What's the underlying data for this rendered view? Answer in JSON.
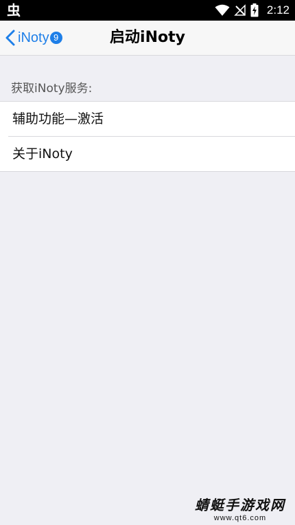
{
  "status_bar": {
    "left_icon_glyph": "虫",
    "time": "2:12",
    "icons": [
      "wifi-icon",
      "signal-off-icon",
      "battery-charging-icon"
    ]
  },
  "nav": {
    "back_label": "iNoty",
    "badge_count": "9",
    "title": "启动iNoty",
    "accent_color": "#1e7fe8"
  },
  "section": {
    "header": "获取iNoty服务:",
    "items": [
      {
        "label": "辅助功能—激活"
      },
      {
        "label": "关于iNoty"
      }
    ]
  },
  "watermark": {
    "title": "蜻蜓手游戏网",
    "url": "www.qt6.com"
  }
}
